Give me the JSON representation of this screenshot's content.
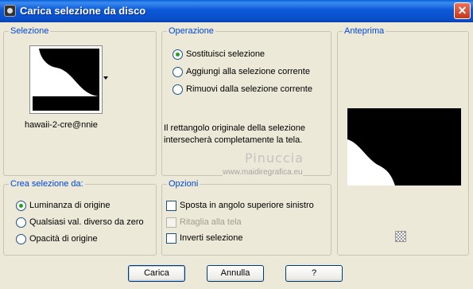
{
  "title": "Carica selezione da disco",
  "colors": {
    "title_bar": "#0a55d6",
    "legend_text": "#0046d5",
    "selected_radio": "#21a121"
  },
  "selezione": {
    "legend": "Selezione",
    "thumbnail_icon": "white-shape-preview",
    "dropdown_icon": "dropdown-arrow",
    "file_name": "hawaii-2-cre@nnie"
  },
  "operazione": {
    "legend": "Operazione",
    "options": [
      {
        "label": "Sostituisci selezione",
        "checked": true
      },
      {
        "label": "Aggiungi alla selezione corrente",
        "checked": false
      },
      {
        "label": "Rimuovi dalla selezione corrente",
        "checked": false
      }
    ],
    "info_line1": "Il rettangolo originale della selezione",
    "info_line2": "intersecherà completamente la tela."
  },
  "watermark": {
    "name": "Pinuccia",
    "url": "www.maidiregrafica.eu"
  },
  "anteprima": {
    "legend": "Anteprima",
    "preview_icon": "selection-preview",
    "zoom_icon": "checker-icon"
  },
  "crea": {
    "legend": "Crea selezione da:",
    "options": [
      {
        "label": "Luminanza di origine",
        "checked": true
      },
      {
        "label": "Qualsiasi val. diverso da zero",
        "checked": false
      },
      {
        "label": "Opacità di origine",
        "checked": false
      }
    ]
  },
  "opzioni": {
    "legend": "Opzioni",
    "items": [
      {
        "label": "Sposta in angolo superiore sinistro",
        "checked": false,
        "disabled": false
      },
      {
        "label": "Ritaglia alla tela",
        "checked": false,
        "disabled": true
      },
      {
        "label": "Inverti selezione",
        "checked": false,
        "disabled": false
      }
    ]
  },
  "buttons": {
    "load": "Carica",
    "cancel": "Annulla",
    "help": "?"
  }
}
